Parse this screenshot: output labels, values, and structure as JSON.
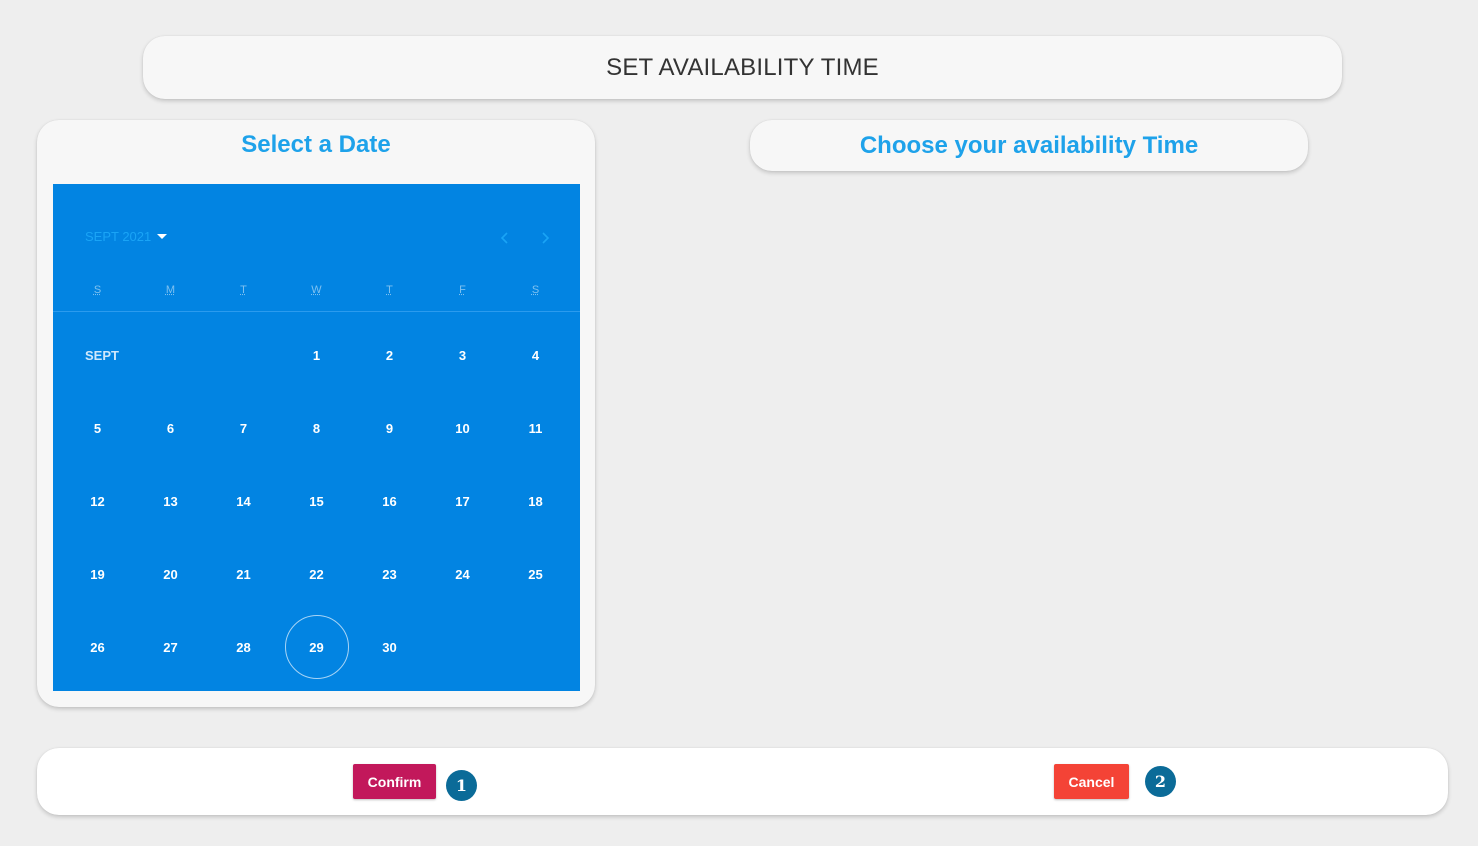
{
  "header": {
    "title": "SET AVAILABILITY TIME"
  },
  "date_panel": {
    "title": "Select a Date",
    "calendar": {
      "month_label": "SEPT 2021",
      "row_month_label": "SEPT",
      "weekdays": [
        "S",
        "M",
        "T",
        "W",
        "T",
        "F",
        "S"
      ],
      "first_weekday_index": 3,
      "days_in_month": 30,
      "selected_day": 29,
      "colors": {
        "background": "#0284e2",
        "month_label": "#1aa4f6",
        "selected_ring": "#a7d4f6"
      }
    }
  },
  "time_panel": {
    "title": "Choose your availability Time"
  },
  "footer": {
    "confirm_label": "Confirm",
    "confirm_step": "1",
    "cancel_label": "Cancel",
    "cancel_step": "2",
    "colors": {
      "confirm": "#c2185b",
      "cancel": "#f44336",
      "step_badge": "#0b6b98"
    }
  },
  "colors": {
    "accent": "#1ea2ea",
    "page_background": "#eeeeee"
  },
  "icons": {
    "prev": "chevron-left-icon",
    "next": "chevron-right-icon",
    "month_dropdown": "caret-down-icon"
  }
}
